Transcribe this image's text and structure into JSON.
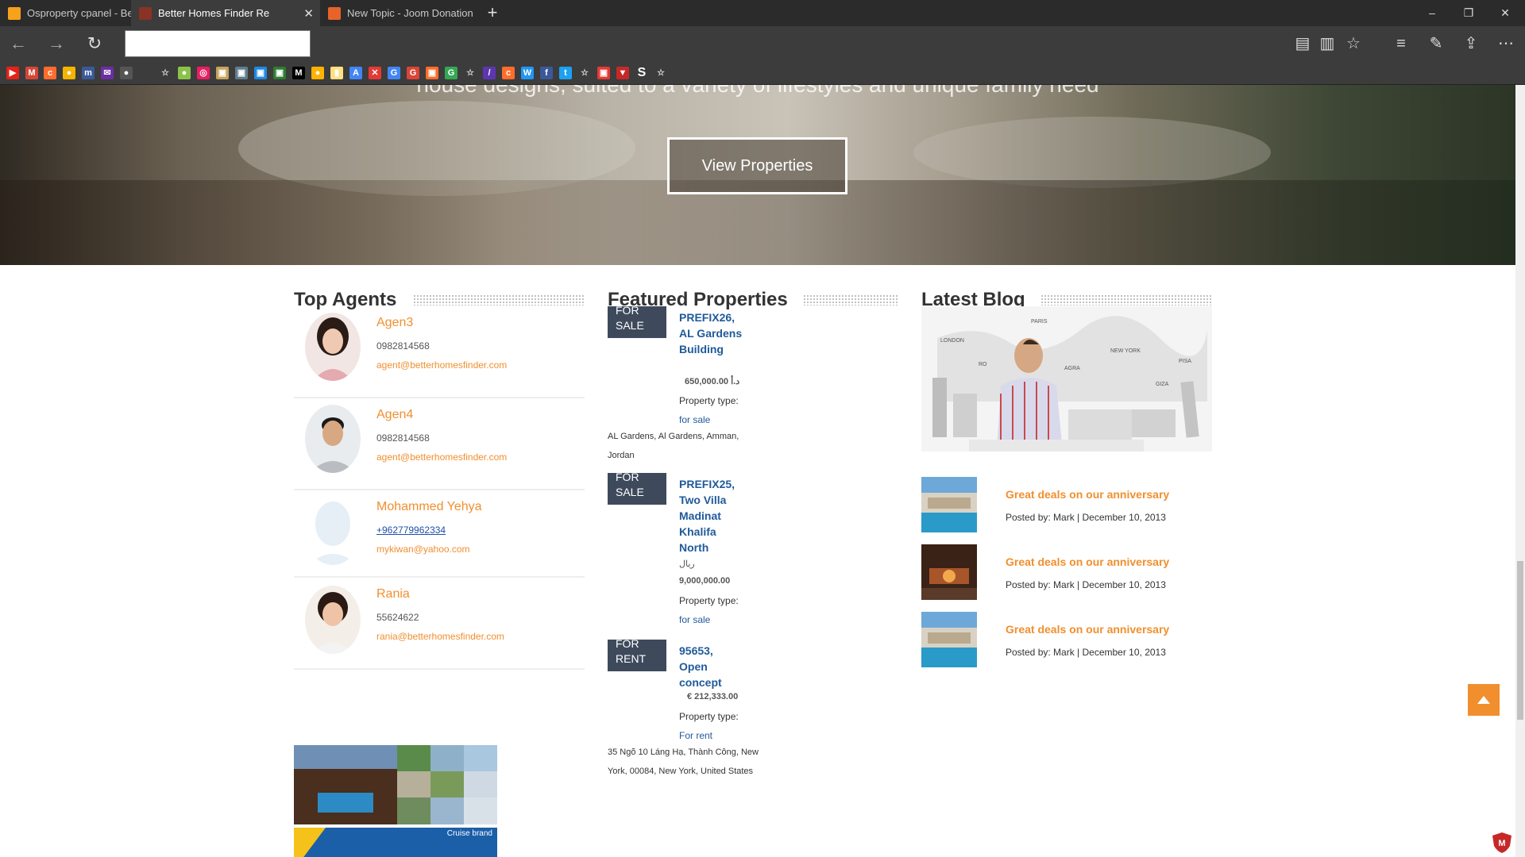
{
  "browser": {
    "tabs": [
      {
        "title": "Osproperty cpanel - Better I",
        "favicon_color": "#f7a21b"
      },
      {
        "title": "Better Homes Finder Re",
        "favicon_color": "#8a3324"
      },
      {
        "title": "New Topic - Joom Donation",
        "favicon_color": "#e8632a"
      }
    ],
    "window_controls": {
      "minimize": "–",
      "maximize": "❐",
      "close": "✕"
    },
    "new_tab": "+",
    "address_value": ""
  },
  "hero": {
    "tagline": "house designs, suited to a variety of lifestyles and unique family need",
    "button_label": "View Properties"
  },
  "top_agents": {
    "title": "Top Agents",
    "agents": [
      {
        "name": "Agen3",
        "phone": "0982814568",
        "email": "agent@betterhomesfinder.com"
      },
      {
        "name": "Agen4",
        "phone": "0982814568",
        "email": "agent@betterhomesfinder.com"
      },
      {
        "name": "Mohammed Yehya",
        "phone": "+962779962334",
        "email": "mykiwan@yahoo.com"
      },
      {
        "name": "Rania",
        "phone": "55624622",
        "email": "rania@betterhomesfinder.com"
      }
    ],
    "ad_caption": "Cruise brand"
  },
  "featured": {
    "title": "Featured Properties",
    "properties": [
      {
        "badge_1": "FOR",
        "badge_2": "SALE",
        "title": "PREFIX26, AL Gardens Building",
        "price": "650,000.00 د.أ",
        "type_label": "Property type:",
        "type_value": "for sale",
        "address": "AL Gardens, Al Gardens, Amman, Jordan"
      },
      {
        "badge_1": "FOR",
        "badge_2": "SALE",
        "title": "PREFIX25, Two Villa Madinat Khalifa North",
        "price_currency": "ريال",
        "price": "9,000,000.00",
        "type_label": "Property type:",
        "type_value": "for sale",
        "address": ""
      },
      {
        "badge_1": "FOR",
        "badge_2": "RENT",
        "title": "95653, Open concept",
        "price": "€ 212,333.00",
        "type_label": "Property type:",
        "type_value": "For rent",
        "address": "35 Ngõ 10 Láng Hạ, Thành Công, New York, 00084, New York, United States"
      }
    ]
  },
  "blog": {
    "title": "Latest Blog",
    "map_cities": [
      "PARIS",
      "LONDON",
      "NEW YORK",
      "AGRA",
      "PISA",
      "GIZA",
      "RO"
    ],
    "posts": [
      {
        "title": "Great deals on our anniversary",
        "meta": "Posted by: Mark | December 10, 2013"
      },
      {
        "title": "Great deals on our anniversary",
        "meta": "Posted by: Mark | December 10, 2013"
      },
      {
        "title": "Great deals on our anniversary",
        "meta": "Posted by: Mark | December 10, 2013"
      }
    ]
  },
  "colors": {
    "accent": "#f18f2e",
    "link": "#1f5a9a",
    "badge": "#3e4a5c",
    "chrome_dark": "#2b2b2b",
    "chrome": "#3c3c3c"
  }
}
